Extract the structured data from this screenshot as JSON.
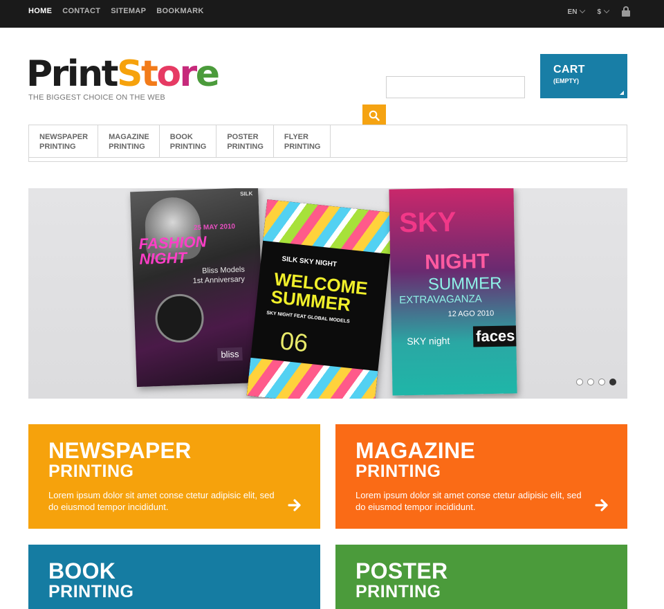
{
  "topbar": {
    "nav": [
      {
        "label": "HOME",
        "active": true
      },
      {
        "label": "CONTACT"
      },
      {
        "label": "SITEMAP"
      },
      {
        "label": "BOOKMARK"
      }
    ],
    "language": "EN",
    "currency": "$"
  },
  "logo": {
    "letters": [
      "P",
      "r",
      "i",
      "n",
      "t",
      "S",
      "t",
      "o",
      "r",
      "e"
    ],
    "colors": [
      "#1c1c1c",
      "#1c1c1c",
      "#1c1c1c",
      "#1c1c1c",
      "#1c1c1c",
      "#f6a20c",
      "#f27b1a",
      "#e63a63",
      "#c62a7b",
      "#4b9b3b"
    ],
    "tagline": "THE BIGGEST CHOICE ON THE WEB"
  },
  "search": {
    "value": "",
    "placeholder": ""
  },
  "cart": {
    "title": "CART",
    "status": "(EMPTY)"
  },
  "menu": [
    {
      "line1": "NEWSPAPER",
      "line2": "PRINTING"
    },
    {
      "line1": "MAGAZINE",
      "line2": "PRINTING"
    },
    {
      "line1": "BOOK",
      "line2": "PRINTING"
    },
    {
      "line1": "POSTER",
      "line2": "PRINTING"
    },
    {
      "line1": "FLYER",
      "line2": "PRINTING"
    }
  ],
  "slider": {
    "flyer1": {
      "corner": "SILK",
      "date": "25 MAY 2010",
      "headline": "FASHION NIGHT",
      "line1": "Bliss Models",
      "line2": "1st Anniversary",
      "badge": "bliss"
    },
    "flyer2": {
      "title": "SILK SKY NIGHT",
      "headline1": "WELCOME",
      "headline2": "SUMMER",
      "line": "SKY NIGHT FEAT GLOBAL MODELS",
      "date": "06"
    },
    "flyer3": {
      "title1": "SKY",
      "title2": "NIGHT",
      "title3": "SUMMER",
      "title4": "EXTRAVAGANZA",
      "date": "12 AGO 2010",
      "brand1": "SKY night",
      "brand2": "faces"
    },
    "slides": 4,
    "active_slide": 4
  },
  "tiles": [
    {
      "title": "NEWSPAPER",
      "subtitle": "PRINTING",
      "desc": "Lorem ipsum dolor sit amet conse ctetur adipisic elit, sed do eiusmod tempor incididunt.",
      "color": "#f6a20c"
    },
    {
      "title": "MAGAZINE",
      "subtitle": "PRINTING",
      "desc": "Lorem ipsum dolor sit amet conse ctetur adipisic elit, sed do eiusmod tempor incididunt.",
      "color": "#fa6b16"
    },
    {
      "title": "BOOK",
      "subtitle": "PRINTING",
      "color": "#157ca2"
    },
    {
      "title": "POSTER",
      "subtitle": "PRINTING",
      "color": "#4b9b3b"
    }
  ]
}
